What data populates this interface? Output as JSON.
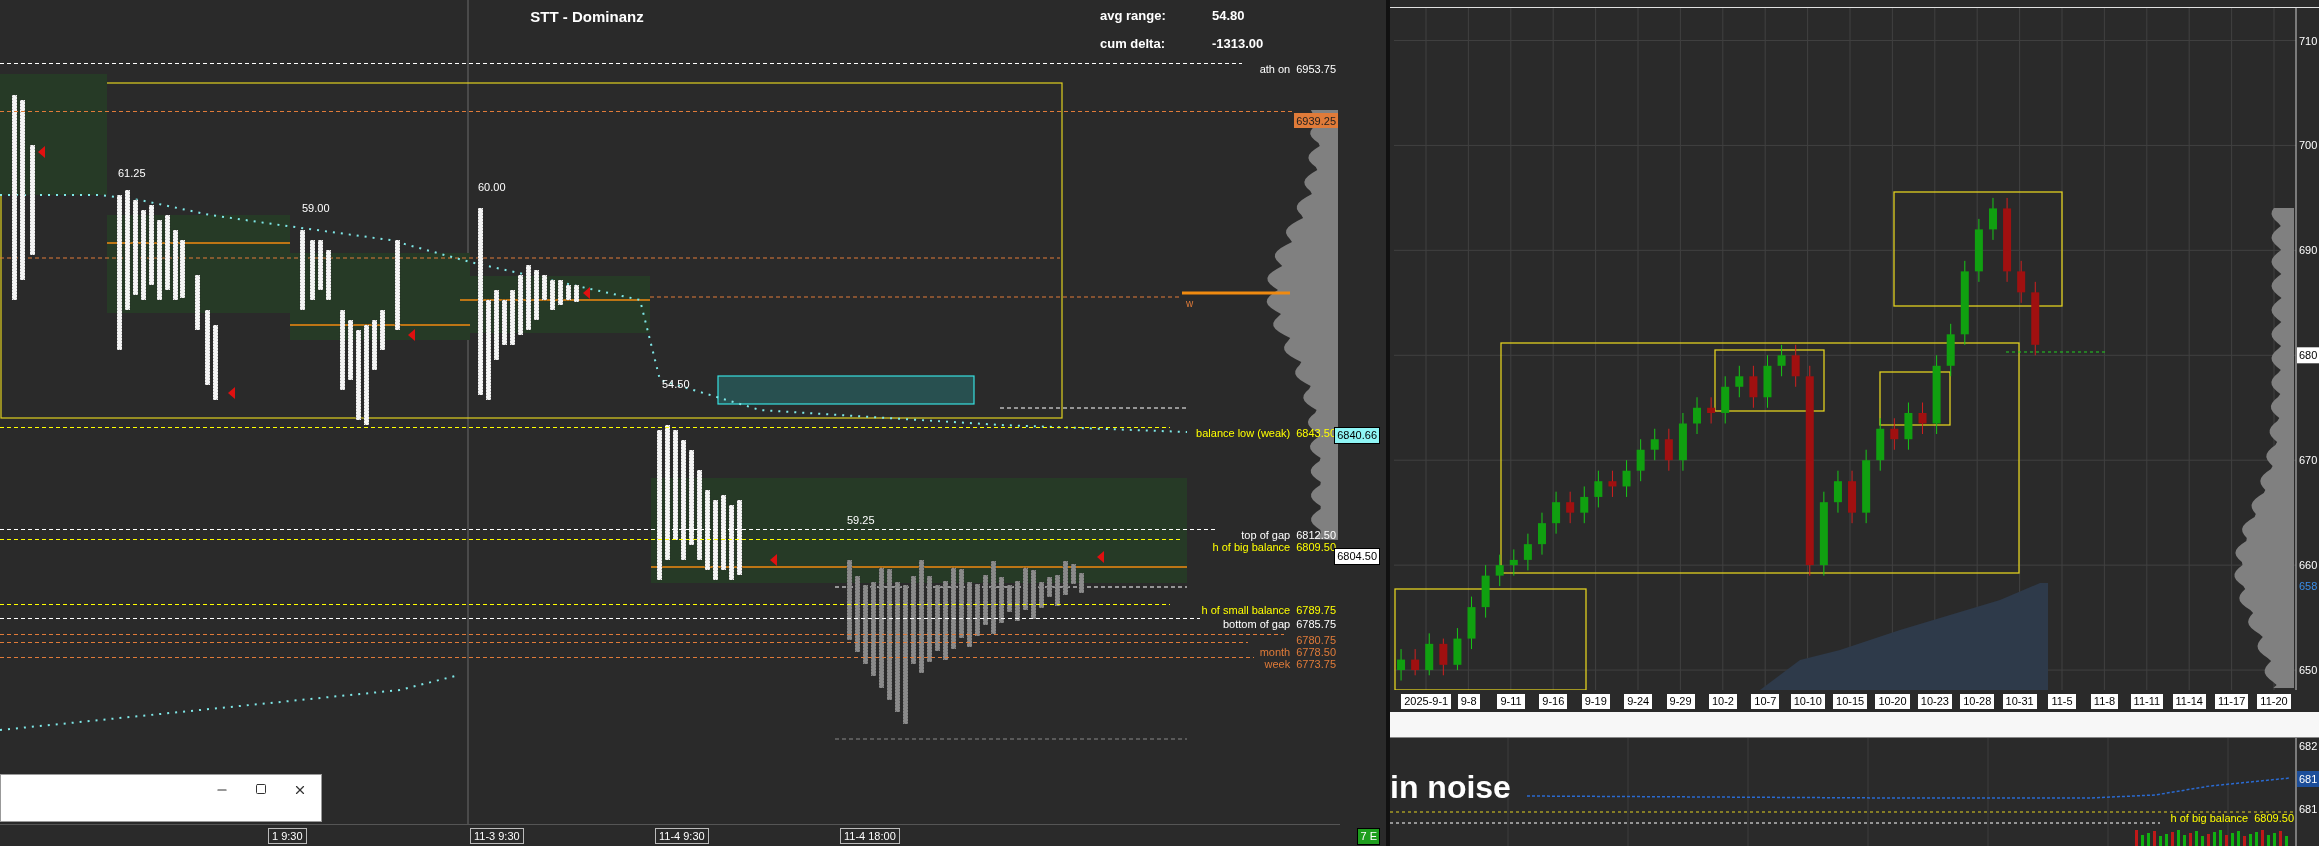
{
  "left_chart": {
    "title": "STT - Dominanz",
    "stats": [
      {
        "label": "avg range:",
        "value": "54.80"
      },
      {
        "label": "cum delta:",
        "value": "-1313.00"
      }
    ],
    "range_labels": [
      "61.25",
      "59.00",
      "60.00",
      "54.50",
      "59.25"
    ],
    "levels": [
      {
        "label": "ath on",
        "price": "6953.75",
        "color": "#ffffff",
        "kind": "line"
      },
      {
        "price": "6939.25",
        "color": "#e07b39",
        "kind": "tag"
      },
      {
        "label": "balance low (weak)",
        "price": "6843.50",
        "color": "#ffff00",
        "kind": "line"
      },
      {
        "label": "top of gap",
        "price": "6812.50",
        "color": "#ffffff",
        "kind": "line"
      },
      {
        "label": "h of big balance",
        "price": "6809.50",
        "color": "#ffff00",
        "kind": "line"
      },
      {
        "label": "h of small balance",
        "price": "6789.75",
        "color": "#ffff00",
        "kind": "line"
      },
      {
        "label": "bottom of gap",
        "price": "6785.75",
        "color": "#ffffff",
        "kind": "line"
      },
      {
        "price": "6780.75",
        "color": "#e07b39",
        "kind": "line"
      },
      {
        "label": "month",
        "price": "6778.50",
        "color": "#e07b39",
        "kind": "line"
      },
      {
        "label": "week",
        "price": "6773.75",
        "color": "#e07b39",
        "kind": "line"
      }
    ],
    "poc_marker": "w",
    "time_axis": [
      "1 9:30",
      "11-3 9:30",
      "11-4 9:30",
      "11-4 18:00"
    ]
  },
  "price_axis": {
    "current": "6840.66",
    "last": "6804.50",
    "badge": "7 E"
  },
  "right_chart": {
    "price_labels": [
      {
        "text": "680",
        "kind": "current"
      },
      {
        "text": "658",
        "kind": "blue"
      }
    ],
    "date_labels": [
      "2025-9-1",
      "9-8",
      "9-11",
      "9-16",
      "9-19",
      "9-24",
      "9-29",
      "10-2",
      "10-7",
      "10-10",
      "10-15",
      "10-20",
      "10-23",
      "10-28",
      "10-31",
      "11-5",
      "11-8",
      "11-11",
      "11-14",
      "11-17",
      "11-20"
    ],
    "chart_data": {
      "type": "candlestick",
      "categories": [
        null,
        null,
        null,
        null,
        null,
        null,
        null,
        null,
        null,
        null,
        null,
        null,
        null,
        null,
        null,
        null,
        null,
        null,
        null,
        null,
        null,
        null,
        null,
        null,
        null,
        null,
        null,
        null,
        null,
        null,
        null,
        null,
        null,
        null,
        null,
        null,
        null,
        null,
        null,
        null,
        null,
        null,
        null,
        null,
        null,
        null,
        null,
        null,
        null,
        null,
        null,
        null,
        null,
        null,
        null,
        null,
        null,
        null,
        null,
        null,
        null,
        null,
        null,
        null
      ],
      "yticks": [
        710,
        700,
        690,
        670,
        660,
        650
      ],
      "ylim": [
        648.1,
        713.1
      ],
      "grid": true,
      "ohlc": [
        [
          650,
          652,
          649,
          651
        ],
        [
          651,
          652,
          649.5,
          650
        ],
        [
          650,
          653.5,
          649.5,
          652.5
        ],
        [
          652.5,
          653,
          649.5,
          650.5
        ],
        [
          650.5,
          654,
          650,
          653
        ],
        [
          653,
          657,
          652,
          656
        ],
        [
          656,
          660,
          655,
          659
        ],
        [
          659,
          661,
          658,
          660
        ],
        [
          660,
          661.5,
          659,
          660.5
        ],
        [
          660.5,
          663,
          659.5,
          662
        ],
        [
          662,
          665,
          661,
          664
        ],
        [
          664,
          667,
          663,
          666
        ],
        [
          666,
          667,
          664,
          665
        ],
        [
          665,
          667.5,
          664,
          666.5
        ],
        [
          666.5,
          669,
          665.5,
          668
        ],
        [
          668,
          669,
          666.5,
          667.5
        ],
        [
          667.5,
          670,
          666.5,
          669
        ],
        [
          669,
          672,
          668,
          671
        ],
        [
          671,
          673,
          670,
          672
        ],
        [
          672,
          673,
          669,
          670
        ],
        [
          670,
          674.5,
          669,
          673.5
        ],
        [
          673.5,
          676,
          672.5,
          675
        ],
        [
          675,
          676,
          673.5,
          674.5
        ],
        [
          674.5,
          678,
          673.5,
          677
        ],
        [
          677,
          679,
          676,
          678
        ],
        [
          678,
          679,
          675,
          676
        ],
        [
          676,
          680,
          675,
          679
        ],
        [
          679,
          681,
          678,
          680
        ],
        [
          680,
          681,
          677,
          678
        ],
        [
          678,
          679,
          659,
          660
        ],
        [
          660,
          667,
          659,
          666
        ],
        [
          666,
          669,
          665,
          668
        ],
        [
          668,
          669,
          664,
          665
        ],
        [
          665,
          671,
          664,
          670
        ],
        [
          670,
          674,
          669,
          673
        ],
        [
          673,
          674,
          671,
          672
        ],
        [
          672,
          675.5,
          671,
          674.5
        ],
        [
          674.5,
          675.5,
          672.5,
          673.5
        ],
        [
          673.5,
          680,
          672.5,
          679
        ],
        [
          679,
          683,
          678,
          682
        ],
        [
          682,
          689,
          681,
          688
        ],
        [
          688,
          693,
          687,
          692
        ],
        [
          692,
          695,
          691,
          694
        ],
        [
          694,
          695,
          687,
          688
        ],
        [
          688,
          689,
          685,
          686
        ],
        [
          686,
          687,
          680,
          681
        ],
        null,
        null,
        null,
        null,
        null,
        null,
        null,
        null,
        null,
        null,
        null,
        null,
        null,
        null,
        null,
        null,
        null,
        null
      ]
    }
  },
  "bottom_pane": {
    "heading": "in noise",
    "price_labels": [
      {
        "text": "682",
        "kind": "plain"
      },
      {
        "text": "681",
        "kind": "blue"
      },
      {
        "text": "681",
        "kind": "plain"
      }
    ],
    "level": {
      "label": "h of big balance",
      "price": "6809.50"
    }
  }
}
